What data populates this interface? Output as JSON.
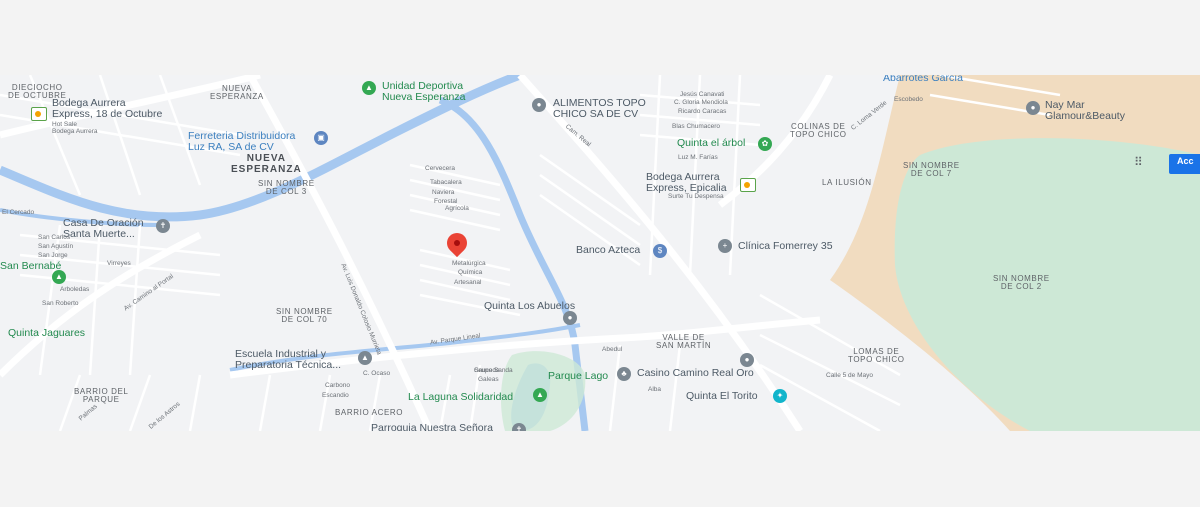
{
  "map": {
    "neighborhoods": [
      {
        "text": "DIECIOCHO\nDE OCTUBRE",
        "cls": "hood"
      },
      {
        "text": "NUEVA\nESPERANZA",
        "cls": "hood"
      },
      {
        "text": "NUEVA\nESPERANZA",
        "cls": "hood-b"
      },
      {
        "text": "SIN NOMBRE\nDE COL 3",
        "cls": "hood"
      },
      {
        "text": "SIN NOMBRE\nDE COL 70",
        "cls": "hood"
      },
      {
        "text": "COLINAS DE\nTOPO CHICO",
        "cls": "hood"
      },
      {
        "text": "LA ILUSIÓN",
        "cls": "hood"
      },
      {
        "text": "SIN NOMBRE\nDE COL 7",
        "cls": "hood"
      },
      {
        "text": "SIN NOMBRE\nDE COL 2",
        "cls": "hood"
      },
      {
        "text": "VALLE DE\nSAN MARTÍN",
        "cls": "hood"
      },
      {
        "text": "LOMAS DE\nTOPO CHICO",
        "cls": "hood"
      },
      {
        "text": "BARRIO DEL\nPARQUE",
        "cls": "hood"
      },
      {
        "text": "BARRIO ACERO",
        "cls": "hood"
      }
    ],
    "pois": [
      {
        "name": "Bodega Aurrera\nExpress, 18 de Octubre",
        "sub": "Hot Sale\nBodega Aurrera",
        "cls": "poi",
        "icon": "store-icon"
      },
      {
        "name": "Unidad Deportiva\nNueva Esperanza",
        "sub": "",
        "cls": "poi-green",
        "icon": "park-icon"
      },
      {
        "name": "ALIMENTOS TOPO\nCHICO SA DE CV",
        "sub": "",
        "cls": "poi",
        "icon": "pin-icon"
      },
      {
        "name": "Ferreteria Distribuidora\nLuz RA, SA de CV",
        "sub": "",
        "cls": "poi-blue",
        "icon": "shopping-icon"
      },
      {
        "name": "Quinta el árbol",
        "sub": "",
        "cls": "poi-green",
        "icon": "leaf-icon"
      },
      {
        "name": "Bodega Aurrera\nExpress, Epicalia",
        "sub": "Surte Tu Despensa",
        "cls": "poi",
        "icon": "store-icon"
      },
      {
        "name": "Casa De Oración\nSanta Muerte...",
        "sub": "",
        "cls": "poi",
        "icon": "religious-icon"
      },
      {
        "name": "Banco Azteca",
        "sub": "",
        "cls": "poi",
        "icon": "bank-icon"
      },
      {
        "name": "Clínica Fomerrey 35",
        "sub": "",
        "cls": "poi",
        "icon": "medical-icon"
      },
      {
        "name": "San Bernabé",
        "sub": "",
        "cls": "poi-green",
        "icon": "park-icon"
      },
      {
        "name": "Quinta Los Abuelos",
        "sub": "",
        "cls": "poi",
        "icon": "pin-icon"
      },
      {
        "name": "Quinta Jaguares",
        "sub": "",
        "cls": "poi-green",
        "icon": ""
      },
      {
        "name": "Escuela Industrial y\nPreparatoria Técnica...",
        "sub": "",
        "cls": "poi",
        "icon": "school-icon"
      },
      {
        "name": "Parque Lago",
        "sub": "",
        "cls": "poi-green",
        "icon": ""
      },
      {
        "name": "Casino Camino Real Oro",
        "sub": "",
        "cls": "poi",
        "icon": "casino-icon"
      },
      {
        "name": "La Laguna Solidaridad",
        "sub": "",
        "cls": "poi-green",
        "icon": "park-icon"
      },
      {
        "name": "Quinta El Torito",
        "sub": "",
        "cls": "poi",
        "icon": "event-icon"
      },
      {
        "name": "Parroquia Nuestra Señora",
        "sub": "",
        "cls": "poi",
        "icon": "church-icon"
      },
      {
        "name": "Abarrotes García",
        "sub": "",
        "cls": "poi-blue",
        "icon": "shopping-icon"
      },
      {
        "name": "Nay Mar\nGlamour&Beauty",
        "sub": "",
        "cls": "poi",
        "icon": "pin-icon"
      }
    ],
    "streets": [
      "Av. Luis Donaldo Colosio Murrieta",
      "Av. Parque Lineal",
      "Av. Camino al Portal",
      "Cam. Real",
      "C. Ocaso",
      "Carbono",
      "Escandio",
      "Cervecera",
      "Tabacalera",
      "Naviera",
      "Forestal",
      "Agrícola",
      "Metalúrgica",
      "Química",
      "Artesanal",
      "San Carlos",
      "San Agustín",
      "San Jorge",
      "Virreyes",
      "Arboledas",
      "San Roberto",
      "Escobedo",
      "C. Loma Verde",
      "Luz M. Farías",
      "Blas Chumacero",
      "C. Gloria Mendiola",
      "Ricardo Caracas",
      "Jesús Canavati",
      "Sauceda",
      "Abedul",
      "Alba",
      "Grupo Sanda",
      "Galeas",
      "Calle 5 de Mayo",
      "El Cercado",
      "Palmas",
      "De los Astros"
    ],
    "controls": {
      "accept_label": "Acc"
    }
  }
}
